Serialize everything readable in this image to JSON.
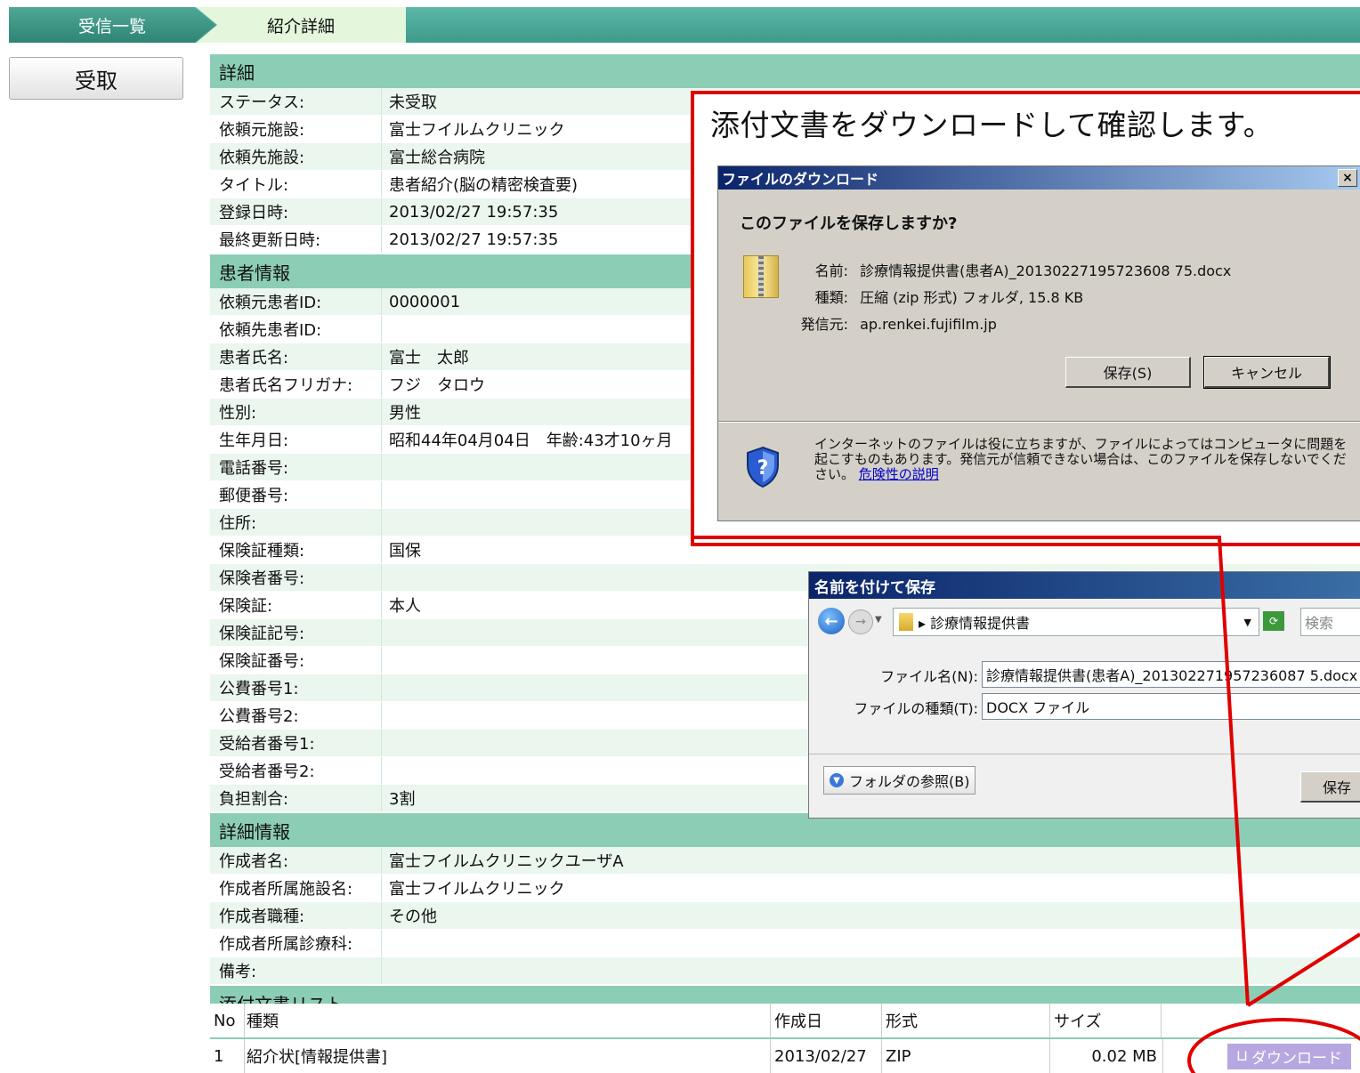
{
  "breadcrumb": {
    "item1": "受信一覧",
    "item2": "紹介詳細"
  },
  "receive_button": "受取",
  "sections": {
    "detail": "詳細",
    "patient": "患者情報",
    "detail_info": "詳細情報",
    "attachments": "添付文書リスト"
  },
  "detail_rows": [
    {
      "label": "ステータス:",
      "value": "未受取"
    },
    {
      "label": "依頼元施設:",
      "value": "富士フイルムクリニック"
    },
    {
      "label": "依頼先施設:",
      "value": "富士総合病院"
    },
    {
      "label": "タイトル:",
      "value": "患者紹介(脳の精密検査要)"
    },
    {
      "label": "登録日時:",
      "value": "2013/02/27 19:57:35"
    },
    {
      "label": "最終更新日時:",
      "value": "2013/02/27 19:57:35"
    }
  ],
  "patient_rows": [
    {
      "label": "依頼元患者ID:",
      "value": "0000001"
    },
    {
      "label": "依頼先患者ID:",
      "value": ""
    },
    {
      "label": "患者氏名:",
      "value": "富士　太郎"
    },
    {
      "label": "患者氏名フリガナ:",
      "value": "フジ　タロウ"
    },
    {
      "label": "性別:",
      "value": "男性"
    },
    {
      "label": "生年月日:",
      "value": "昭和44年04月04日　年齢:43才10ヶ月"
    },
    {
      "label": "電話番号:",
      "value": ""
    },
    {
      "label": "郵便番号:",
      "value": ""
    },
    {
      "label": "住所:",
      "value": ""
    },
    {
      "label": "保険証種類:",
      "value": "国保"
    },
    {
      "label": "保険者番号:",
      "value": ""
    },
    {
      "label": "保険証:",
      "value": "本人"
    },
    {
      "label": "保険証記号:",
      "value": ""
    },
    {
      "label": "保険証番号:",
      "value": ""
    },
    {
      "label": "公費番号1:",
      "value": ""
    },
    {
      "label": "公費番号2:",
      "value": ""
    },
    {
      "label": "受給者番号1:",
      "value": ""
    },
    {
      "label": "受給者番号2:",
      "value": ""
    },
    {
      "label": "負担割合:",
      "value": "3割"
    }
  ],
  "detail_info_rows": [
    {
      "label": "作成者名:",
      "value": "富士フイルムクリニックユーザA"
    },
    {
      "label": "作成者所属施設名:",
      "value": "富士フイルムクリニック"
    },
    {
      "label": "作成者職種:",
      "value": "その他"
    },
    {
      "label": "作成者所属診療科:",
      "value": ""
    },
    {
      "label": "備考:",
      "value": ""
    }
  ],
  "attach_header": {
    "no": "No",
    "type": "種類",
    "date": "作成日",
    "format": "形式",
    "size": "サイズ"
  },
  "attach_rows": [
    {
      "no": "1",
      "type": "紹介状[情報提供書]",
      "date": "2013/02/27",
      "format": "ZIP",
      "size": "0.02 MB",
      "action": "ダウンロード"
    }
  ],
  "callout": "添付文書をダウンロードして確認します。",
  "download_dialog": {
    "title": "ファイルのダウンロード",
    "close": "×",
    "question": "このファイルを保存しますか?",
    "name_label": "名前:",
    "name": "診療情報提供書(患者A)_20130227195723608 75.docx",
    "type_label": "種類:",
    "type": "圧縮 (zip 形式) フォルダ, 15.8 KB",
    "from_label": "発信元:",
    "from": "ap.renkei.fujifilm.jp",
    "save": "保存(S)",
    "cancel": "キャンセル",
    "warning": "インターネットのファイルは役に立ちますが、ファイルによってはコンピュータに問題を起こすものもあります。発信元が信頼できない場合は、このファイルを保存しないでください。",
    "risk_link": "危険性の説明"
  },
  "save_as": {
    "title": "名前を付けて保存",
    "path": "▸ 診療情報提供書",
    "search_placeholder": "検索",
    "filename_label": "ファイル名(N):",
    "filename": "診療情報提供書(患者A)_201302271957236087 5.docx",
    "filetype_label": "ファイルの種類(T):",
    "filetype": "DOCX ファイル",
    "browse": "フォルダの参照(B)",
    "save": "保存"
  },
  "colors": {
    "header_green": "#8ccdb5",
    "accent_red": "#e00000",
    "row_alt": "#eaf6ee"
  }
}
